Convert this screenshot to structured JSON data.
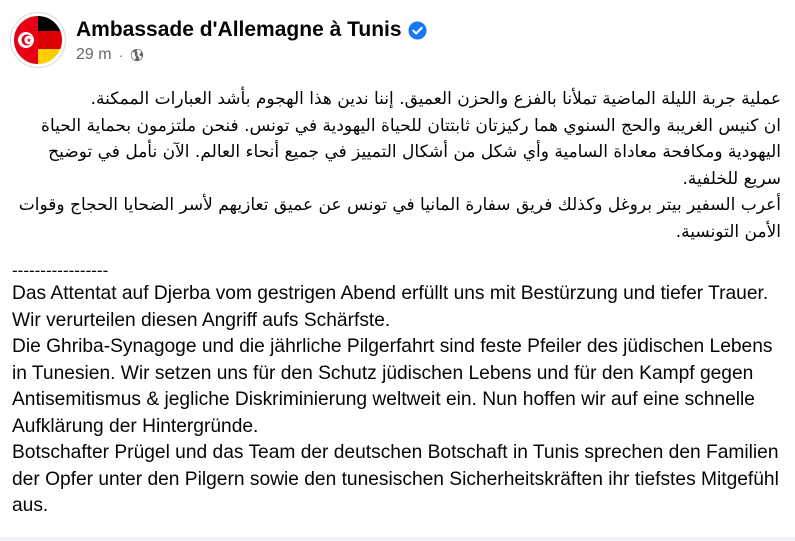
{
  "post": {
    "page_name": "Ambassade d'Allemagne à Tunis",
    "timestamp": "29 m",
    "separator_dot": "·",
    "verified_icon": "verified-badge-icon",
    "audience_icon": "globe-icon",
    "arabic_paragraphs": [
      "عملية جربة الليلة الماضية تملأنا بالفزع والحزن العميق. إننا ندين هذا الهجوم بأشد العبارات الممكنة.",
      "ان كنيس الغريبة والحج السنوي هما ركيزتان ثابتتان للحياة اليهودية في تونس. فنحن ملتزمون بحماية الحياة اليهودية ومكافحة معاداة السامية وأي شكل من أشكال التمييز في جميع أنحاء العالم. الآن نأمل في توضيح سريع للخلفية.",
      "أعرب السفير بيتر بروغل وكذلك فريق سفارة المانيا في تونس عن عميق تعازيهم لأسر الضحايا الحجاج وقوات الأمن التونسية."
    ],
    "separator_line": "-----------------",
    "german_paragraphs": [
      "Das Attentat auf Djerba vom gestrigen Abend erfüllt uns mit Bestürzung und tiefer Trauer. Wir verurteilen diesen Angriff aufs Schärfste.",
      "Die Ghriba-Synagoge und die jährliche Pilgerfahrt sind feste Pfeiler des jüdischen Lebens in Tunesien. Wir setzen uns für den Schutz jüdischen Lebens und für den Kampf gegen Antisemitismus & jegliche Diskriminierung weltweit ein. Nun hoffen wir auf eine schnelle Aufklärung der Hintergründe.",
      "Botschafter Prügel und das Team der deutschen Botschaft in Tunis sprechen den Familien der Opfer unter den Pilgern sowie den tunesischen Sicherheitskräften ihr tiefstes Mitgefühl aus."
    ]
  },
  "colors": {
    "verified_blue": "#1877f2",
    "meta_gray": "#65676b",
    "flag_black": "#000000",
    "flag_red": "#dd0000",
    "flag_gold": "#ffce00",
    "tunisia_red": "#e70013"
  }
}
